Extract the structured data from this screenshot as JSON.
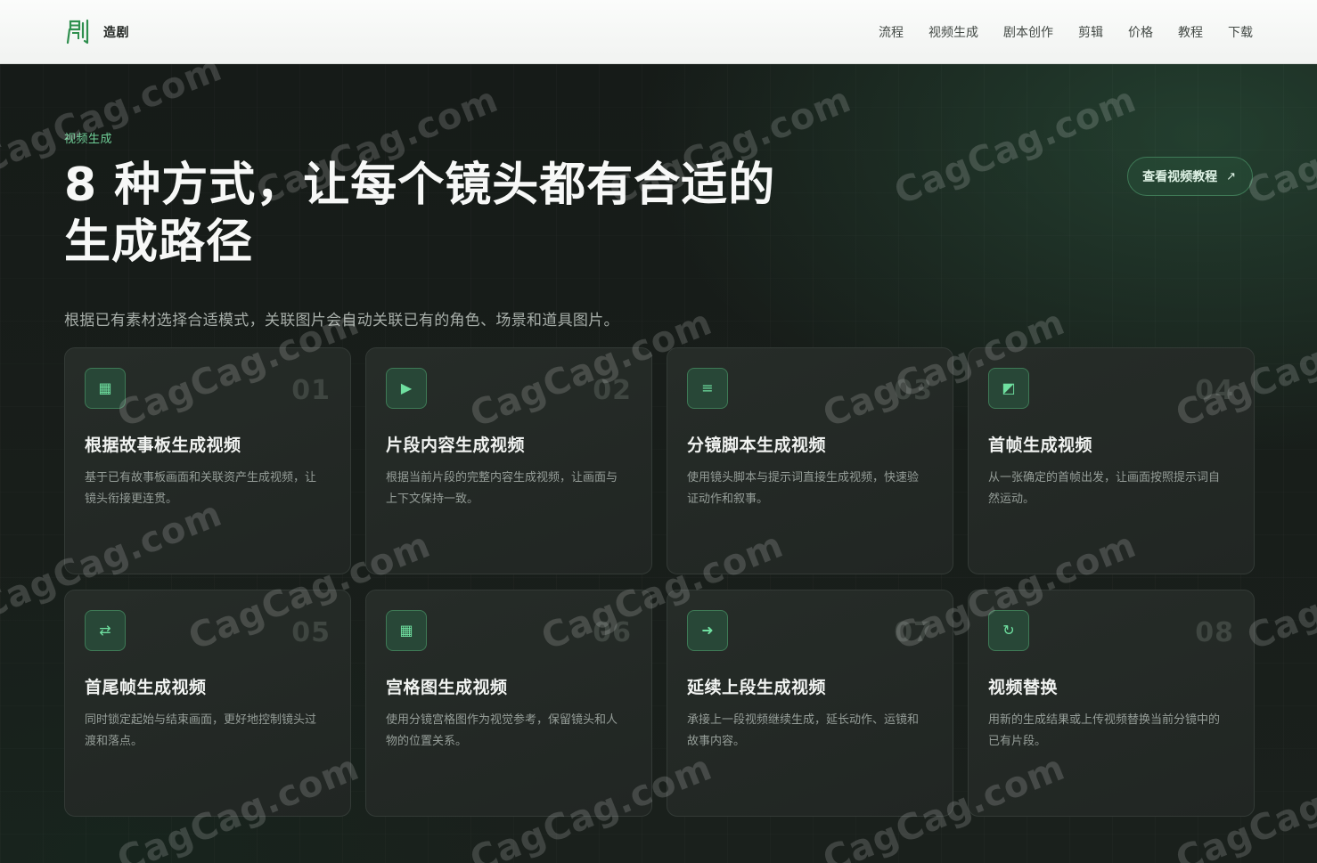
{
  "brand": {
    "name": "造剧"
  },
  "nav": {
    "items": [
      {
        "label": "流程"
      },
      {
        "label": "视频生成"
      },
      {
        "label": "剧本创作"
      },
      {
        "label": "剪辑"
      },
      {
        "label": "价格"
      },
      {
        "label": "教程"
      },
      {
        "label": "下载"
      }
    ]
  },
  "hero": {
    "eyebrow": "视频生成",
    "title_line1": "8 种方式，让每个镜头都有合适的",
    "title_line2": "生成路径",
    "subtitle": "根据已有素材选择合适模式，关联图片会自动关联已有的角色、场景和道具图片。",
    "tutorial_button": {
      "label": "查看视频教程",
      "icon": "arrow-up-right-icon",
      "glyph": "↗"
    }
  },
  "cards": [
    {
      "number": "01",
      "icon": "storyboard-grid-icon",
      "glyph": "▦",
      "title": "根据故事板生成视频",
      "description": "基于已有故事板画面和关联资产生成视频，让镜头衔接更连贯。"
    },
    {
      "number": "02",
      "icon": "play-icon",
      "glyph": "▶",
      "title": "片段内容生成视频",
      "description": "根据当前片段的完整内容生成视频，让画面与上下文保持一致。"
    },
    {
      "number": "03",
      "icon": "list-icon",
      "glyph": "≡",
      "title": "分镜脚本生成视频",
      "description": "使用镜头脚本与提示词直接生成视频，快速验证动作和叙事。"
    },
    {
      "number": "04",
      "icon": "first-frame-icon",
      "glyph": "◩",
      "title": "首帧生成视频",
      "description": "从一张确定的首帧出发，让画面按照提示词自然运动。"
    },
    {
      "number": "05",
      "icon": "swap-arrows-icon",
      "glyph": "⇄",
      "title": "首尾帧生成视频",
      "description": "同时锁定起始与结束画面，更好地控制镜头过渡和落点。"
    },
    {
      "number": "06",
      "icon": "grid-icon",
      "glyph": "▦",
      "title": "宫格图生成视频",
      "description": "使用分镜宫格图作为视觉参考，保留镜头和人物的位置关系。"
    },
    {
      "number": "07",
      "icon": "arrow-right-icon",
      "glyph": "➜",
      "title": "延续上段生成视频",
      "description": "承接上一段视频继续生成，延长动作、运镜和故事内容。"
    },
    {
      "number": "08",
      "icon": "refresh-icon",
      "glyph": "↻",
      "title": "视频替换",
      "description": "用新的生成结果或上传视频替换当前分镜中的已有片段。"
    }
  ],
  "watermark": {
    "text": "CagCag.com"
  },
  "colors": {
    "accent": "#6fcf97",
    "background": "#171c19",
    "card": "#242a26"
  }
}
